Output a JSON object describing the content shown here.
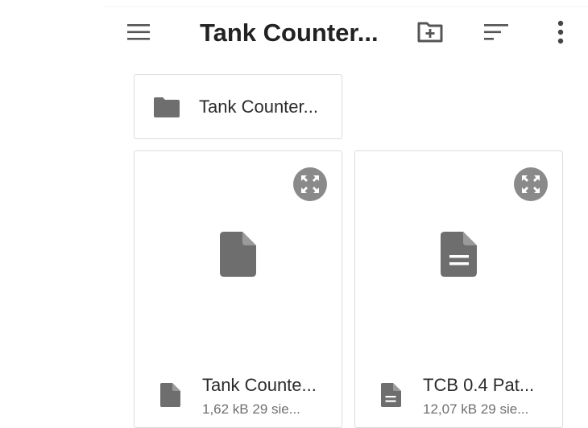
{
  "toolbar": {
    "title": "Tank Counter...",
    "menu_icon": "menu-icon",
    "new_folder_icon": "create-new-folder-icon",
    "sort_icon": "sort-icon",
    "more_icon": "more-vert-icon"
  },
  "folders": [
    {
      "name": "Tank Counter...",
      "icon": "folder-icon"
    }
  ],
  "files": [
    {
      "name": "Tank Counte...",
      "meta": "1,62 kB 29 sie...",
      "icon": "file-icon"
    },
    {
      "name": "TCB 0.4 Pat...",
      "meta": "12,07 kB 29 sie...",
      "icon": "text-file-icon"
    }
  ],
  "colors": {
    "icon_gray": "#6e6e6e",
    "badge_gray": "#8a8a8a",
    "text_dark": "#2b2b2b",
    "text_secondary": "#6f6f6f",
    "card_border": "#dcdcdc"
  }
}
